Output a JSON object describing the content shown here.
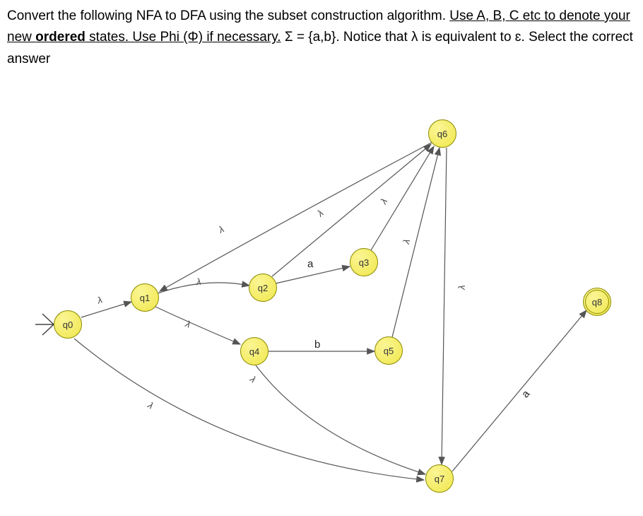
{
  "question": {
    "p1a": "Convert the following NFA to DFA using the subset construction algorithm. ",
    "p1b": "Use A, B, C etc to denote your new ",
    "p1c": "ordered",
    "p1d": " states. Use Phi (Φ) if necessary.",
    "p1e": "   Σ = {a,b}. Notice that λ is equivalent to ɛ. Select the correct answer"
  },
  "states": {
    "q0": "q0",
    "q1": "q1",
    "q2": "q2",
    "q3": "q3",
    "q4": "q4",
    "q5": "q5",
    "q6": "q6",
    "q7": "q7",
    "q8": "q8"
  },
  "labels": {
    "l_q0q1": "λ",
    "l_q1q2": "λ",
    "l_q1q4": "λ",
    "l_q2q3": "a",
    "l_q2q6": "λ",
    "l_q4q5": "b",
    "l_q4q7": "λ",
    "l_q3q6": "λ",
    "l_q5q6": "λ",
    "l_q6q1": "λ",
    "l_q6q7": "λ",
    "l_q0q7": "λ",
    "l_q7q8": "a"
  },
  "chart_data": {
    "type": "graph",
    "title": "NFA state diagram",
    "alphabet": [
      "a",
      "b"
    ],
    "lambda_symbol": "λ",
    "nodes": [
      {
        "id": "q0",
        "start": true,
        "accept": false
      },
      {
        "id": "q1",
        "start": false,
        "accept": false
      },
      {
        "id": "q2",
        "start": false,
        "accept": false
      },
      {
        "id": "q3",
        "start": false,
        "accept": false
      },
      {
        "id": "q4",
        "start": false,
        "accept": false
      },
      {
        "id": "q5",
        "start": false,
        "accept": false
      },
      {
        "id": "q6",
        "start": false,
        "accept": false
      },
      {
        "id": "q7",
        "start": false,
        "accept": false
      },
      {
        "id": "q8",
        "start": false,
        "accept": true
      }
    ],
    "edges": [
      {
        "from": "q0",
        "to": "q1",
        "label": "λ"
      },
      {
        "from": "q1",
        "to": "q2",
        "label": "λ"
      },
      {
        "from": "q1",
        "to": "q4",
        "label": "λ"
      },
      {
        "from": "q2",
        "to": "q3",
        "label": "a"
      },
      {
        "from": "q2",
        "to": "q6",
        "label": "λ"
      },
      {
        "from": "q4",
        "to": "q5",
        "label": "b"
      },
      {
        "from": "q4",
        "to": "q7",
        "label": "λ"
      },
      {
        "from": "q3",
        "to": "q6",
        "label": "λ"
      },
      {
        "from": "q5",
        "to": "q6",
        "label": "λ"
      },
      {
        "from": "q6",
        "to": "q1",
        "label": "λ"
      },
      {
        "from": "q6",
        "to": "q7",
        "label": "λ"
      },
      {
        "from": "q0",
        "to": "q7",
        "label": "λ"
      },
      {
        "from": "q7",
        "to": "q8",
        "label": "a"
      }
    ]
  }
}
